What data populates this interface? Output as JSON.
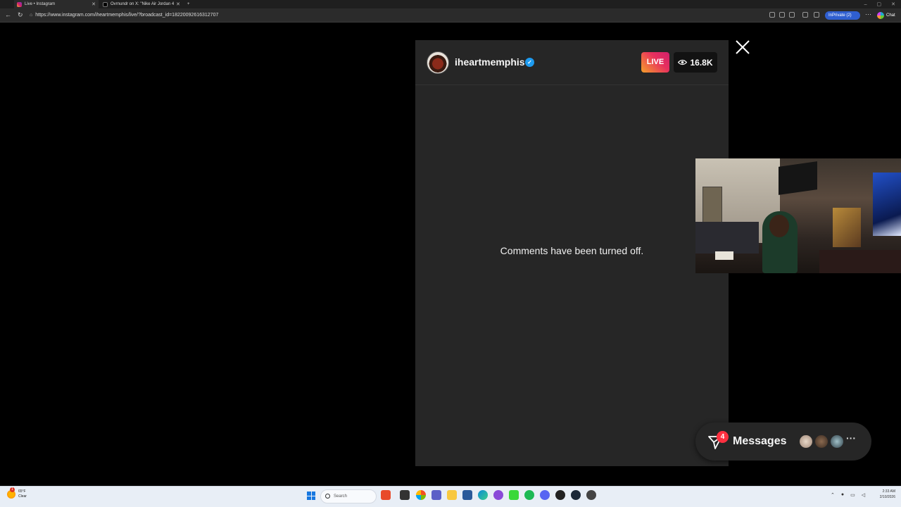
{
  "browser": {
    "tabs": [
      {
        "label": "Live • Instagram",
        "active": true
      },
      {
        "label": "Ovrnundr on X: \"Nike Air Jordan 4",
        "active": false
      }
    ],
    "new_tab": "+",
    "url": "https://www.instagram.com/iheartmemphis/live/?broadcast_id=18220092616312707",
    "inprivate_label": "InPrivate (2)",
    "chat_label": "Chat",
    "icons": [
      "back-icon",
      "refresh-icon",
      "new-tab-icon",
      "favorites-icon",
      "extensions-icon",
      "more-icon"
    ]
  },
  "live": {
    "username": "iheartmemphis",
    "verified": true,
    "live_label": "LIVE",
    "viewer_count": "16.8K",
    "comments_notice": "Comments have been turned off.",
    "close_label": "close"
  },
  "messages": {
    "label": "Messages",
    "badge_count": "4",
    "more": "···"
  },
  "taskbar": {
    "weather_temp": "65°F",
    "weather_desc": "Clear",
    "weather_badge": "1",
    "search_placeholder": "Search",
    "time": "2:33 AM",
    "date": "2/10/2026"
  },
  "colors": {
    "panel_bg": "#262626",
    "live_gradient_start": "#f4a02a",
    "live_gradient_end": "#d0206b",
    "verified": "#1d9bf0",
    "badge_red": "#ff3040"
  }
}
